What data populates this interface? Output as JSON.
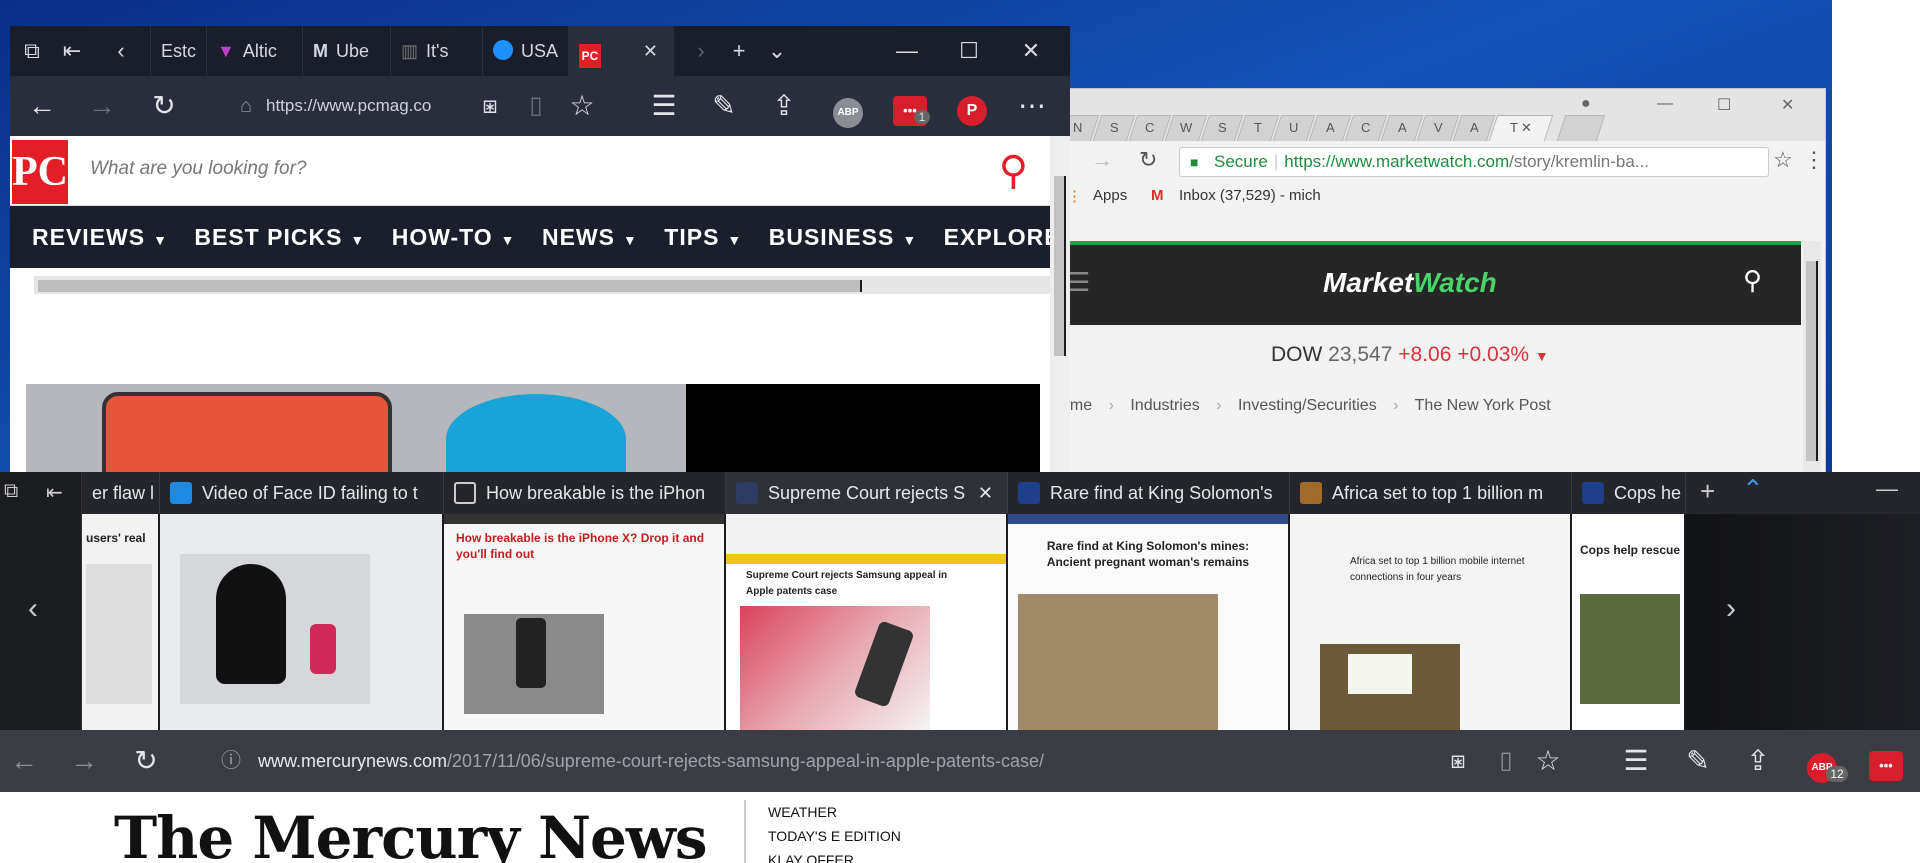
{
  "edge_top": {
    "tabs": [
      "Estc",
      "Altic",
      "Ube",
      "It's",
      "USA"
    ],
    "url": "https://www.pcmag.co",
    "extensions": {
      "abp_label": "ABP",
      "lastpass_badge": "1"
    }
  },
  "pcmag": {
    "logo": "PC",
    "search_placeholder": "What are you looking for?",
    "nav": [
      "REVIEWS",
      "BEST PICKS",
      "HOW-TO",
      "NEWS",
      "TIPS",
      "BUSINESS",
      "EXPLORE"
    ]
  },
  "chrome": {
    "tab_letters": [
      "N",
      "S",
      "C",
      "W",
      "S",
      "T",
      "U",
      "A",
      "C",
      "A",
      "V",
      "A",
      "T"
    ],
    "secure_label": "Secure",
    "url_main": "https://www.marketwatch.com",
    "url_rest": "/story/kremlin-ba...",
    "bookmarks": {
      "apps": "Apps",
      "inbox": "Inbox (37,529) - mich"
    }
  },
  "marketwatch": {
    "logo_market": "Market",
    "logo_watch": "Watch",
    "dow_label": "DOW",
    "dow_value": "23,547",
    "dow_change": "+8.06",
    "dow_pct": "+0.03%",
    "breadcrumb": [
      "ome",
      "Industries",
      "Investing/Securities",
      "The New York Post"
    ]
  },
  "tab_strip": {
    "tabs": [
      {
        "label": "er flaw l",
        "color": "#555a66"
      },
      {
        "label": "Video of Face ID failing to t",
        "color": "#1e88e5"
      },
      {
        "label": "How breakable is the iPhon",
        "color": "#444851"
      },
      {
        "label": "Supreme Court rejects S",
        "color": "#2c3b5e"
      },
      {
        "label": "Rare find at King Solomon's",
        "color": "#1f3f8a"
      },
      {
        "label": "Africa set to top 1 billion m",
        "color": "#a06a2a"
      },
      {
        "label": "Cops he",
        "color": "#1f3f8a"
      }
    ],
    "previews": {
      "p0": "users' real",
      "p2": "How breakable is the iPhone X? Drop it and you'll find out",
      "p3": "Supreme Court rejects Samsung appeal in Apple patents case",
      "p4": "Rare find at King Solomon's mines: Ancient pregnant woman's remains",
      "p5": "Africa set to top 1 billion mobile internet connections in four years",
      "p6": "Cops help rescue"
    }
  },
  "edge_bottom": {
    "url_host": "www.mercurynews.com",
    "url_path": "/2017/11/06/supreme-court-rejects-samsung-appeal-in-apple-patents-case/",
    "abp_badge": "12"
  },
  "mercury": {
    "logo": "The Mercury News",
    "links": [
      "WEATHER",
      "TODAY'S E EDITION",
      "KLAY OFFER"
    ]
  }
}
